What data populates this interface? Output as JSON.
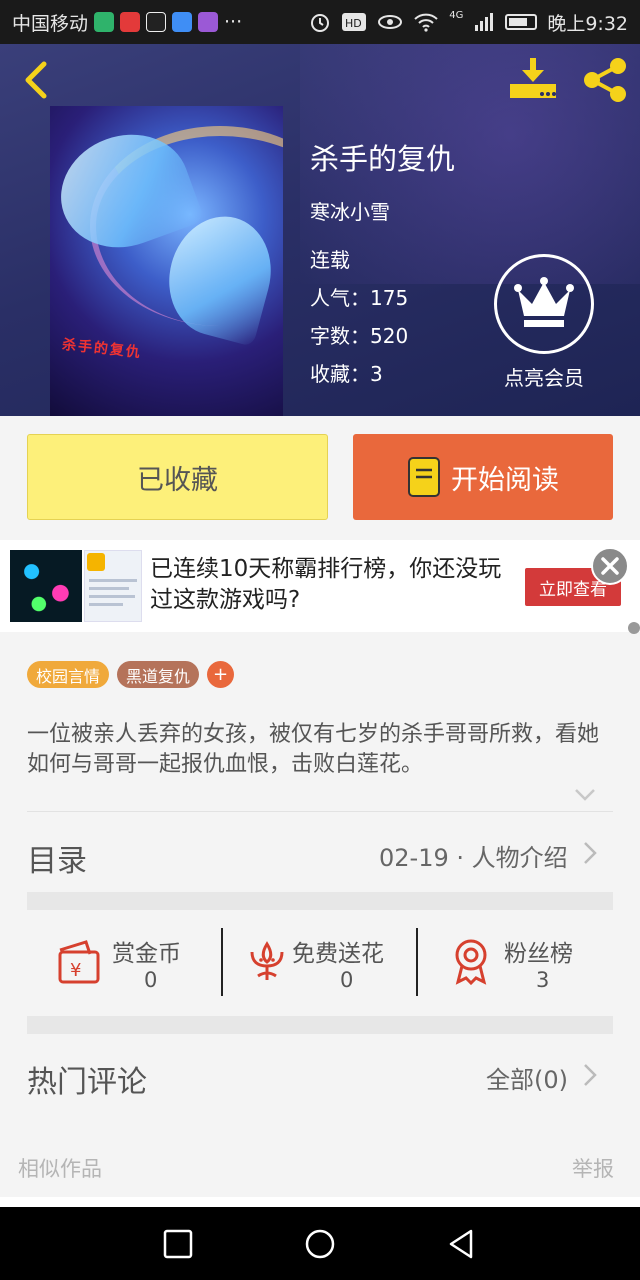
{
  "status_bar": {
    "carrier": "中国移动",
    "more": "···",
    "network": "4G",
    "time": "晚上9:32"
  },
  "book": {
    "title": "杀手的复仇",
    "author": "寒冰小雪",
    "status": "连载",
    "stats": [
      "人气：175",
      "字数：520",
      "收藏：3"
    ],
    "cover_caption": "杀手的复仇"
  },
  "vip": {
    "label": "点亮会员"
  },
  "actions": {
    "collected": "已收藏",
    "start_reading": "开始阅读"
  },
  "ad": {
    "text": "已连续10天称霸排行榜，你还没玩过这款游戏吗?",
    "cta": "立即查看"
  },
  "tags": [
    {
      "label": "校园言情",
      "color": "#f0a93b"
    },
    {
      "label": "黑道复仇",
      "color": "#b5735a"
    }
  ],
  "tag_add": "+",
  "synopsis": "一位被亲人丢弃的女孩，被仅有七岁的杀手哥哥所救，看她如何与哥哥一起报仇血恨，击败白莲花。",
  "catalog": {
    "title": "目录",
    "latest": "02-19 · 人物介绍"
  },
  "rewards": [
    {
      "label": "赏金币",
      "value": "0"
    },
    {
      "label": "免费送花",
      "value": "0"
    },
    {
      "label": "粉丝榜",
      "value": "3"
    }
  ],
  "comments": {
    "title": "热门评论",
    "all": "全部(0)"
  },
  "footer": {
    "similar": "相似作品",
    "report": "举报"
  },
  "colors": {
    "accent_orange": "#e9683c",
    "collected_yellow": "#fdf07a",
    "icon_red": "#d6402e",
    "top_icon_yellow": "#f5d21a"
  }
}
